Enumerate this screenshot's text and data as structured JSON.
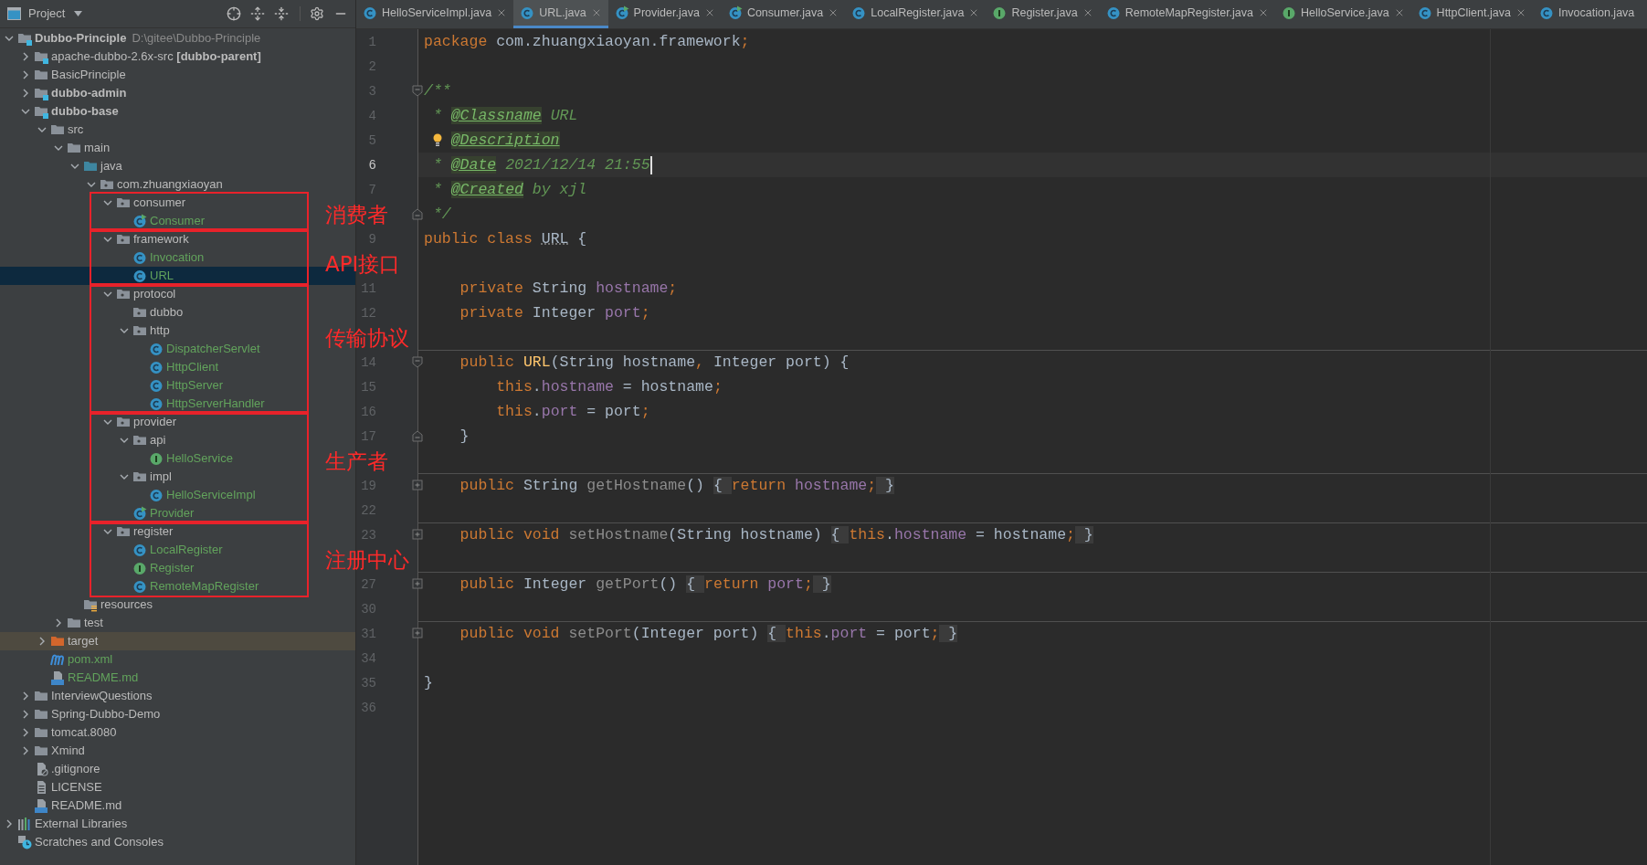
{
  "sidebar": {
    "title": "Project"
  },
  "tree": [
    {
      "label": "Dubbo-Principle",
      "path": "D:\\gitee\\Dubbo-Principle",
      "kind": "module",
      "bold": true,
      "added": false,
      "selected": false,
      "highlighted": false,
      "expanded": true,
      "children": [
        {
          "label": "apache-dubbo-2.6x-src **[dubbo-parent]**",
          "kind": "module",
          "bold": false,
          "added": false,
          "selected": false,
          "highlighted": false,
          "expanded": false
        },
        {
          "label": "BasicPrinciple",
          "kind": "folder",
          "bold": false,
          "added": false,
          "selected": false,
          "highlighted": false,
          "expanded": false
        },
        {
          "label": "dubbo-admin",
          "kind": "module",
          "bold": true,
          "added": false,
          "selected": false,
          "highlighted": false,
          "expanded": false
        },
        {
          "label": "dubbo-base",
          "kind": "module",
          "bold": true,
          "added": false,
          "selected": false,
          "highlighted": false,
          "expanded": true,
          "children": [
            {
              "label": "src",
              "kind": "folder",
              "bold": false,
              "added": false,
              "selected": false,
              "highlighted": false,
              "expanded": true,
              "children": [
                {
                  "label": "main",
                  "kind": "folder",
                  "bold": false,
                  "added": false,
                  "selected": false,
                  "highlighted": false,
                  "expanded": true,
                  "children": [
                    {
                      "label": "java",
                      "kind": "source-folder",
                      "bold": false,
                      "added": false,
                      "selected": false,
                      "highlighted": false,
                      "expanded": true,
                      "children": [
                        {
                          "label": "com.zhuangxiaoyan",
                          "kind": "package",
                          "bold": false,
                          "added": false,
                          "selected": false,
                          "highlighted": false,
                          "expanded": true,
                          "children": [
                            {
                              "label": "consumer",
                              "kind": "package",
                              "annotation": "消费者",
                              "bold": false,
                              "added": false,
                              "selected": false,
                              "highlighted": false,
                              "expanded": true,
                              "children": [
                                {
                                  "label": "Consumer",
                                  "kind": "runnable",
                                  "bold": false,
                                  "added": true,
                                  "selected": false,
                                  "highlighted": false
                                }
                              ]
                            },
                            {
                              "label": "framework",
                              "kind": "package",
                              "annotation": "API接口",
                              "bold": false,
                              "added": false,
                              "selected": false,
                              "highlighted": false,
                              "expanded": true,
                              "children": [
                                {
                                  "label": "Invocation",
                                  "kind": "class",
                                  "bold": false,
                                  "added": true,
                                  "selected": false,
                                  "highlighted": false
                                },
                                {
                                  "label": "URL",
                                  "kind": "class",
                                  "bold": false,
                                  "added": true,
                                  "selected": true,
                                  "highlighted": false
                                }
                              ]
                            },
                            {
                              "label": "protocol",
                              "kind": "package",
                              "annotation": "传输协议",
                              "bold": false,
                              "added": false,
                              "selected": false,
                              "highlighted": false,
                              "expanded": true,
                              "children": [
                                {
                                  "label": "dubbo",
                                  "kind": "package",
                                  "bold": false,
                                  "added": false,
                                  "selected": false,
                                  "highlighted": false
                                },
                                {
                                  "label": "http",
                                  "kind": "package",
                                  "bold": false,
                                  "added": false,
                                  "selected": false,
                                  "highlighted": false,
                                  "expanded": true,
                                  "children": [
                                    {
                                      "label": "DispatcherServlet",
                                      "kind": "class",
                                      "bold": false,
                                      "added": true,
                                      "selected": false,
                                      "highlighted": false
                                    },
                                    {
                                      "label": "HttpClient",
                                      "kind": "class",
                                      "bold": false,
                                      "added": true,
                                      "selected": false,
                                      "highlighted": false
                                    },
                                    {
                                      "label": "HttpServer",
                                      "kind": "class",
                                      "bold": false,
                                      "added": true,
                                      "selected": false,
                                      "highlighted": false
                                    },
                                    {
                                      "label": "HttpServerHandler",
                                      "kind": "class",
                                      "bold": false,
                                      "added": true,
                                      "selected": false,
                                      "highlighted": false
                                    }
                                  ]
                                }
                              ]
                            },
                            {
                              "label": "provider",
                              "kind": "package",
                              "annotation": "生产者",
                              "bold": false,
                              "added": false,
                              "selected": false,
                              "highlighted": false,
                              "expanded": true,
                              "children": [
                                {
                                  "label": "api",
                                  "kind": "package",
                                  "bold": false,
                                  "added": false,
                                  "selected": false,
                                  "highlighted": false,
                                  "expanded": true,
                                  "children": [
                                    {
                                      "label": "HelloService",
                                      "kind": "interface",
                                      "bold": false,
                                      "added": true,
                                      "selected": false,
                                      "highlighted": false
                                    }
                                  ]
                                },
                                {
                                  "label": "impl",
                                  "kind": "package",
                                  "bold": false,
                                  "added": false,
                                  "selected": false,
                                  "highlighted": false,
                                  "expanded": true,
                                  "children": [
                                    {
                                      "label": "HelloServiceImpl",
                                      "kind": "class",
                                      "bold": false,
                                      "added": true,
                                      "selected": false,
                                      "highlighted": false
                                    }
                                  ]
                                },
                                {
                                  "label": "Provider",
                                  "kind": "runnable",
                                  "bold": false,
                                  "added": true,
                                  "selected": false,
                                  "highlighted": false
                                }
                              ]
                            },
                            {
                              "label": "register",
                              "kind": "package",
                              "annotation": "注册中心",
                              "bold": false,
                              "added": false,
                              "selected": false,
                              "highlighted": false,
                              "expanded": true,
                              "children": [
                                {
                                  "label": "LocalRegister",
                                  "kind": "class",
                                  "bold": false,
                                  "added": true,
                                  "selected": false,
                                  "highlighted": false
                                },
                                {
                                  "label": "Register",
                                  "kind": "interface",
                                  "bold": false,
                                  "added": true,
                                  "selected": false,
                                  "highlighted": false
                                },
                                {
                                  "label": "RemoteMapRegister",
                                  "kind": "class",
                                  "bold": false,
                                  "added": true,
                                  "selected": false,
                                  "highlighted": false
                                }
                              ]
                            }
                          ]
                        }
                      ]
                    },
                    {
                      "label": "resources",
                      "kind": "resources",
                      "bold": false,
                      "added": false,
                      "selected": false,
                      "highlighted": false
                    }
                  ]
                },
                {
                  "label": "test",
                  "kind": "folder",
                  "bold": false,
                  "added": false,
                  "selected": false,
                  "highlighted": false,
                  "expanded": false
                }
              ]
            },
            {
              "label": "target",
              "kind": "excluded-folder",
              "bold": false,
              "added": false,
              "selected": false,
              "highlighted": true,
              "expanded": false
            },
            {
              "label": "pom.xml",
              "kind": "maven",
              "bold": false,
              "added": true,
              "selected": false,
              "highlighted": false
            },
            {
              "label": "README.md",
              "kind": "markdown",
              "bold": false,
              "added": true,
              "selected": false,
              "highlighted": false
            }
          ]
        },
        {
          "label": "InterviewQuestions",
          "kind": "folder",
          "bold": false,
          "added": false,
          "selected": false,
          "highlighted": false,
          "expanded": false
        },
        {
          "label": "Spring-Dubbo-Demo",
          "kind": "folder",
          "bold": false,
          "added": false,
          "selected": false,
          "highlighted": false,
          "expanded": false
        },
        {
          "label": "tomcat.8080",
          "kind": "folder",
          "bold": false,
          "added": false,
          "selected": false,
          "highlighted": false,
          "expanded": false
        },
        {
          "label": "Xmind",
          "kind": "folder",
          "bold": false,
          "added": false,
          "selected": false,
          "highlighted": false,
          "expanded": false
        },
        {
          "label": ".gitignore",
          "kind": "gitignore",
          "bold": false,
          "added": false,
          "selected": false,
          "highlighted": false
        },
        {
          "label": "LICENSE",
          "kind": "text-file",
          "bold": false,
          "added": false,
          "selected": false,
          "highlighted": false
        },
        {
          "label": "README.md",
          "kind": "markdown",
          "bold": false,
          "added": false,
          "selected": false,
          "highlighted": false
        }
      ]
    },
    {
      "label": "External Libraries",
      "kind": "libraries",
      "bold": false,
      "added": false,
      "selected": false,
      "highlighted": false,
      "expanded": false
    },
    {
      "label": "Scratches and Consoles",
      "kind": "scratches",
      "bold": false,
      "added": false,
      "selected": false,
      "highlighted": false
    }
  ],
  "tabs": [
    {
      "label": "HelloServiceImpl.java",
      "kind": "class",
      "selected": false,
      "closable": true
    },
    {
      "label": "URL.java",
      "kind": "class",
      "selected": true,
      "closable": true
    },
    {
      "label": "Provider.java",
      "kind": "runnable",
      "selected": false,
      "closable": true
    },
    {
      "label": "Consumer.java",
      "kind": "runnable",
      "selected": false,
      "closable": true
    },
    {
      "label": "LocalRegister.java",
      "kind": "class",
      "selected": false,
      "closable": true
    },
    {
      "label": "Register.java",
      "kind": "interface",
      "selected": false,
      "closable": true
    },
    {
      "label": "RemoteMapRegister.java",
      "kind": "class",
      "selected": false,
      "closable": true
    },
    {
      "label": "HelloService.java",
      "kind": "interface",
      "selected": false,
      "closable": true
    },
    {
      "label": "HttpClient.java",
      "kind": "class",
      "selected": false,
      "closable": true
    },
    {
      "label": "Invocation.java",
      "kind": "class",
      "selected": false,
      "closable": false
    }
  ],
  "code": [
    {
      "num": "1",
      "current": false,
      "separator": false,
      "tokens": [
        {
          "text": "package ",
          "kind": "keyword"
        },
        {
          "text": "com.zhuangxiaoyan.framework",
          "kind": "plain"
        },
        {
          "text": ";",
          "kind": "keyword"
        }
      ]
    },
    {
      "num": "2",
      "current": false,
      "separator": false
    },
    {
      "num": "3",
      "current": false,
      "separator": false,
      "fold": {
        "kind": "start"
      },
      "tokens": [
        {
          "text": "/**",
          "kind": "doc"
        }
      ]
    },
    {
      "num": "4",
      "current": false,
      "separator": false,
      "tokens": [
        {
          "text": " * ",
          "kind": "doc"
        },
        {
          "text": "@Classname",
          "kind": "tag"
        },
        {
          "text": " URL",
          "kind": "doc"
        }
      ]
    },
    {
      "num": "5",
      "current": false,
      "separator": false,
      "bulb": true,
      "tokens": [
        {
          "text": "@Description",
          "kind": "tag"
        }
      ]
    },
    {
      "num": "6",
      "current": true,
      "separator": false,
      "tokens": [
        {
          "text": " * ",
          "kind": "doc"
        },
        {
          "text": "@Date",
          "kind": "tag"
        },
        {
          "text": " 2021/12/14 21:55",
          "kind": "doc"
        }
      ]
    },
    {
      "num": "7",
      "current": false,
      "separator": false,
      "tokens": [
        {
          "text": " * ",
          "kind": "doc"
        },
        {
          "text": "@Created",
          "kind": "tag"
        },
        {
          "text": " by xjl",
          "kind": "doc"
        }
      ]
    },
    {
      "current": false,
      "separator": false,
      "fold": {
        "kind": "end"
      },
      "tokens": [
        {
          "text": " */",
          "kind": "doc"
        }
      ]
    },
    {
      "num": "9",
      "current": false,
      "separator": false,
      "tokens": [
        {
          "text": "public class ",
          "kind": "keyword"
        },
        {
          "text": "URL",
          "kind": "warning"
        },
        {
          "text": " {",
          "kind": "plain"
        }
      ]
    },
    {
      "current": false,
      "separator": false
    },
    {
      "num": "11",
      "current": false,
      "separator": false,
      "tokens": [
        {
          "text": "    private ",
          "kind": "keyword"
        },
        {
          "text": "String ",
          "kind": "plain"
        },
        {
          "text": "hostname",
          "kind": "field"
        },
        {
          "text": ";",
          "kind": "keyword"
        }
      ]
    },
    {
      "num": "12",
      "current": false,
      "separator": false,
      "tokens": [
        {
          "text": "    private ",
          "kind": "keyword"
        },
        {
          "text": "Integer ",
          "kind": "plain"
        },
        {
          "text": "port",
          "kind": "field"
        },
        {
          "text": ";",
          "kind": "keyword"
        }
      ]
    },
    {
      "current": false,
      "separator": false
    },
    {
      "num": "14",
      "current": false,
      "separator": true,
      "fold": {
        "kind": "start"
      },
      "tokens": [
        {
          "text": "    public ",
          "kind": "keyword"
        },
        {
          "text": "URL",
          "kind": "declaration"
        },
        {
          "text": "(String hostname",
          "kind": "plain"
        },
        {
          "text": ", ",
          "kind": "keyword"
        },
        {
          "text": "Integer port) {",
          "kind": "plain"
        }
      ]
    },
    {
      "num": "15",
      "current": false,
      "separator": false,
      "tokens": [
        {
          "text": "        this",
          "kind": "keyword"
        },
        {
          "text": ".",
          "kind": "plain"
        },
        {
          "text": "hostname",
          "kind": "field"
        },
        {
          "text": " = hostname",
          "kind": "plain"
        },
        {
          "text": ";",
          "kind": "keyword"
        }
      ]
    },
    {
      "num": "16",
      "current": false,
      "separator": false,
      "tokens": [
        {
          "text": "        this",
          "kind": "keyword"
        },
        {
          "text": ".",
          "kind": "plain"
        },
        {
          "text": "port",
          "kind": "field"
        },
        {
          "text": " = port",
          "kind": "plain"
        },
        {
          "text": ";",
          "kind": "keyword"
        }
      ]
    },
    {
      "num": "17",
      "current": false,
      "separator": false,
      "fold": {
        "kind": "end"
      },
      "tokens": [
        {
          "text": "    }",
          "kind": "plain"
        }
      ]
    },
    {
      "current": false,
      "separator": false
    },
    {
      "num": "19",
      "current": false,
      "separator": true,
      "fold": {
        "kind": "folded"
      },
      "tokens": [
        {
          "text": "    public ",
          "kind": "keyword"
        },
        {
          "text": "String ",
          "kind": "plain"
        },
        {
          "text": "getHostname",
          "kind": "method"
        },
        {
          "text": "() ",
          "kind": "plain"
        },
        {
          "text": "{ ",
          "kind": "fold"
        },
        {
          "text": "return ",
          "kind": "keyword"
        },
        {
          "text": "hostname",
          "kind": "field"
        },
        {
          "text": ";",
          "kind": "keyword"
        },
        {
          "text": " }",
          "kind": "fold"
        }
      ]
    },
    {
      "num": "22",
      "current": false,
      "separator": false
    },
    {
      "num": "23",
      "current": false,
      "separator": true,
      "fold": {
        "kind": "folded"
      },
      "tokens": [
        {
          "text": "    public void ",
          "kind": "keyword"
        },
        {
          "text": "setHostname",
          "kind": "method"
        },
        {
          "text": "(String hostname) ",
          "kind": "plain"
        },
        {
          "text": "{ ",
          "kind": "fold"
        },
        {
          "text": "this",
          "kind": "keyword"
        },
        {
          "text": ".",
          "kind": "plain"
        },
        {
          "text": "hostname",
          "kind": "field"
        },
        {
          "text": " = hostname",
          "kind": "plain"
        },
        {
          "text": ";",
          "kind": "keyword"
        },
        {
          "text": " }",
          "kind": "fold"
        }
      ]
    },
    {
      "current": false,
      "separator": false
    },
    {
      "num": "27",
      "current": false,
      "separator": true,
      "fold": {
        "kind": "folded"
      },
      "tokens": [
        {
          "text": "    public ",
          "kind": "keyword"
        },
        {
          "text": "Integer ",
          "kind": "plain"
        },
        {
          "text": "getPort",
          "kind": "method"
        },
        {
          "text": "() ",
          "kind": "plain"
        },
        {
          "text": "{ ",
          "kind": "fold"
        },
        {
          "text": "return ",
          "kind": "keyword"
        },
        {
          "text": "port",
          "kind": "field"
        },
        {
          "text": ";",
          "kind": "keyword"
        },
        {
          "text": " }",
          "kind": "fold"
        }
      ]
    },
    {
      "num": "30",
      "current": false,
      "separator": false
    },
    {
      "num": "31",
      "current": false,
      "separator": true,
      "fold": {
        "kind": "folded"
      },
      "tokens": [
        {
          "text": "    public void ",
          "kind": "keyword"
        },
        {
          "text": "setPort",
          "kind": "method"
        },
        {
          "text": "(Integer port) ",
          "kind": "plain"
        },
        {
          "text": "{ ",
          "kind": "fold"
        },
        {
          "text": "this",
          "kind": "keyword"
        },
        {
          "text": ".",
          "kind": "plain"
        },
        {
          "text": "port",
          "kind": "field"
        },
        {
          "text": " = port",
          "kind": "plain"
        },
        {
          "text": ";",
          "kind": "keyword"
        },
        {
          "text": " }",
          "kind": "fold"
        }
      ]
    },
    {
      "num": "34",
      "current": false,
      "separator": false
    },
    {
      "num": "35",
      "current": false,
      "separator": false,
      "tokens": [
        {
          "text": "}",
          "kind": "plain"
        }
      ]
    },
    {
      "num": "36",
      "current": false,
      "separator": false
    }
  ]
}
